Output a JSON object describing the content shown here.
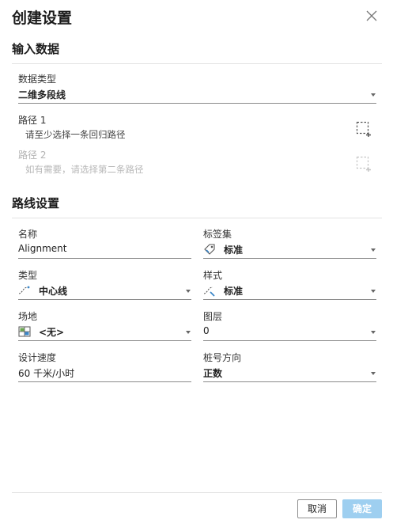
{
  "dialog": {
    "title": "创建设置"
  },
  "input_section": {
    "title": "输入数据",
    "data_type": {
      "label": "数据类型",
      "value": "二维多段线"
    },
    "path1": {
      "label": "路径 1",
      "hint": "请至少选择一条回归路径"
    },
    "path2": {
      "label": "路径 2",
      "hint": "如有需要，请选择第二条路径"
    }
  },
  "route_section": {
    "title": "路线设置",
    "name": {
      "label": "名称",
      "value": "Alignment"
    },
    "label_set": {
      "label": "标签集",
      "value": "标准",
      "icon": "label-set-icon"
    },
    "type": {
      "label": "类型",
      "value": "中心线",
      "icon": "centerline-icon"
    },
    "style": {
      "label": "样式",
      "value": "标准",
      "icon": "style-icon"
    },
    "site": {
      "label": "场地",
      "value": "<无>",
      "icon": "site-icon"
    },
    "layer": {
      "label": "图层",
      "value": "0"
    },
    "design_speed": {
      "label": "设计速度",
      "value": "60 千米/小时"
    },
    "station_direction": {
      "label": "桩号方向",
      "value": "正数"
    }
  },
  "footer": {
    "cancel_label": "取消",
    "ok_label": "确定"
  },
  "colors": {
    "accent": "#9ecff0",
    "divider": "#e3e3e3",
    "underline": "#8a8a8a"
  }
}
